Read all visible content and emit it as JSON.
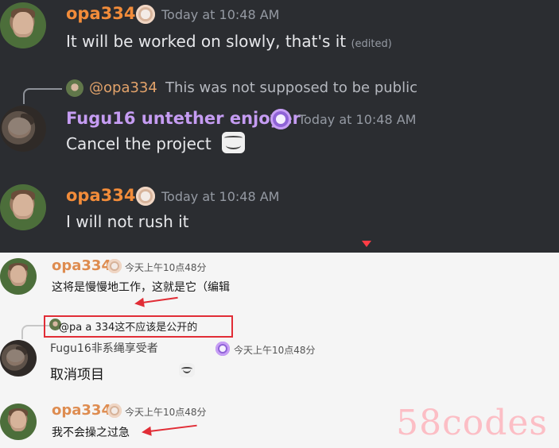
{
  "top": {
    "messages": [
      {
        "username": "opa334",
        "timestamp": "Today at 10:48 AM",
        "text": "It will be worked on slowly, that's it",
        "edited_label": "(edited)"
      },
      {
        "reply_username": "@opa334",
        "reply_text": "This was not supposed to be public",
        "username": "Fugu16 untether enjoyer",
        "timestamp": "Today at 10:48 AM",
        "text": "Cancel the project"
      },
      {
        "username": "opa334",
        "timestamp": "Today at 10:48 AM",
        "text": "I will not rush it"
      }
    ]
  },
  "bottom": {
    "messages": [
      {
        "username": "opa334",
        "timestamp": "今天上午10点48分",
        "text": "这将是慢慢地工作，这就是它（编辑"
      },
      {
        "reply_text": "@pa a 334这不应该是公开的",
        "username": "Fugu16非系绳享受者",
        "timestamp": "今天上午10点48分",
        "text": "取消项目"
      },
      {
        "username": "opa334",
        "timestamp": "今天上午10点48分",
        "text": "我不会操之过急"
      }
    ]
  },
  "watermark": "58codes",
  "colors": {
    "dark_bg": "#2b2d31",
    "light_bg": "#f5f5f5",
    "orange_name": "#f28c3a",
    "purple_name": "#c59cf2",
    "annotation_red": "#e12d36"
  }
}
